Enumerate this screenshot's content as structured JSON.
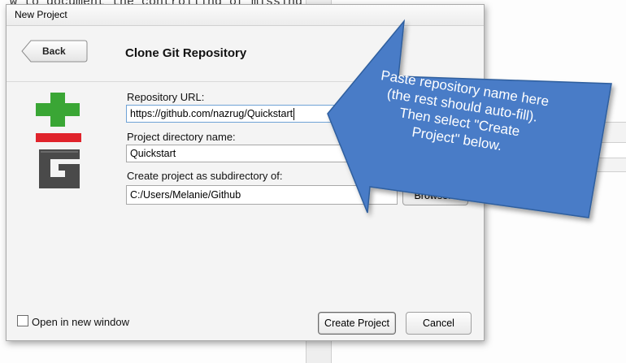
{
  "background": {
    "editor_text": "w to document the controlling of missing"
  },
  "dialog": {
    "window_title": "New Project",
    "back_label": "Back",
    "header_title": "Clone Git Repository",
    "repo_url": {
      "label": "Repository URL:",
      "value": "https://github.com/nazrug/Quickstart"
    },
    "project_dir": {
      "label": "Project directory name:",
      "value": "Quickstart"
    },
    "subdir": {
      "label": "Create project as subdirectory of:",
      "value": "C:/Users/Melanie/Github"
    },
    "browse_label": "Browse...",
    "open_new_window": {
      "label": "Open in new window",
      "checked": false
    },
    "create_label": "Create Project",
    "cancel_label": "Cancel"
  },
  "callout": {
    "text": "Paste repository name here (the rest should auto-fill). Then select \"Create Project\" below.",
    "color": "#4a7cc7"
  },
  "colors": {
    "git_green": "#3aa635",
    "git_red": "#e0232b",
    "git_dark": "#4a4a4a"
  }
}
